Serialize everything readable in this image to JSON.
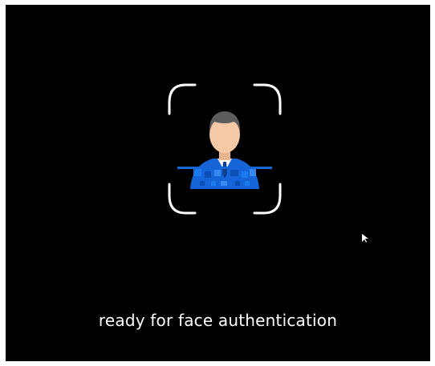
{
  "screen": {
    "status_message": "ready for face authentication"
  },
  "icons": {
    "scanner_frame": "face-scan-frame-icon",
    "user_avatar": "user-avatar-icon",
    "scan_line": "scan-line-icon",
    "cursor": "mouse-cursor-icon"
  },
  "colors": {
    "background": "#000000",
    "frame": "#ffffff",
    "accent": "#1565d8",
    "skin": "#f5c9a6",
    "hair": "#5c5c5c",
    "text": "#ffffff"
  }
}
